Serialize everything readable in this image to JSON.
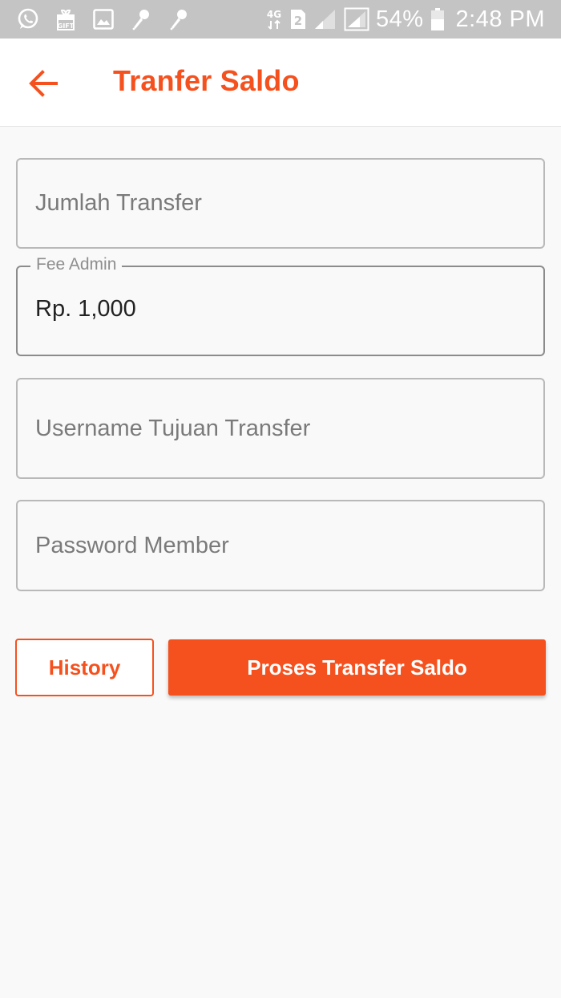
{
  "status_bar": {
    "icons_left": [
      "whatsapp-icon",
      "gift-icon",
      "image-icon",
      "microphone-icon",
      "microphone-icon"
    ],
    "network_label": "4G",
    "sim_label": "2",
    "battery_percent": "54%",
    "time": "2:48 PM"
  },
  "header": {
    "title": "Tranfer Saldo",
    "back_icon": "arrow-left-icon"
  },
  "form": {
    "amount_placeholder": "Jumlah Transfer",
    "fee": {
      "label": "Fee Admin",
      "value": "Rp. 1,000"
    },
    "username_placeholder": "Username Tujuan Transfer",
    "password_placeholder": "Password Member"
  },
  "actions": {
    "history_label": "History",
    "submit_label": "Proses Transfer Saldo"
  },
  "colors": {
    "accent": "#f5511e",
    "status_bar": "#c4c4c4",
    "background": "#f9f9f9"
  }
}
